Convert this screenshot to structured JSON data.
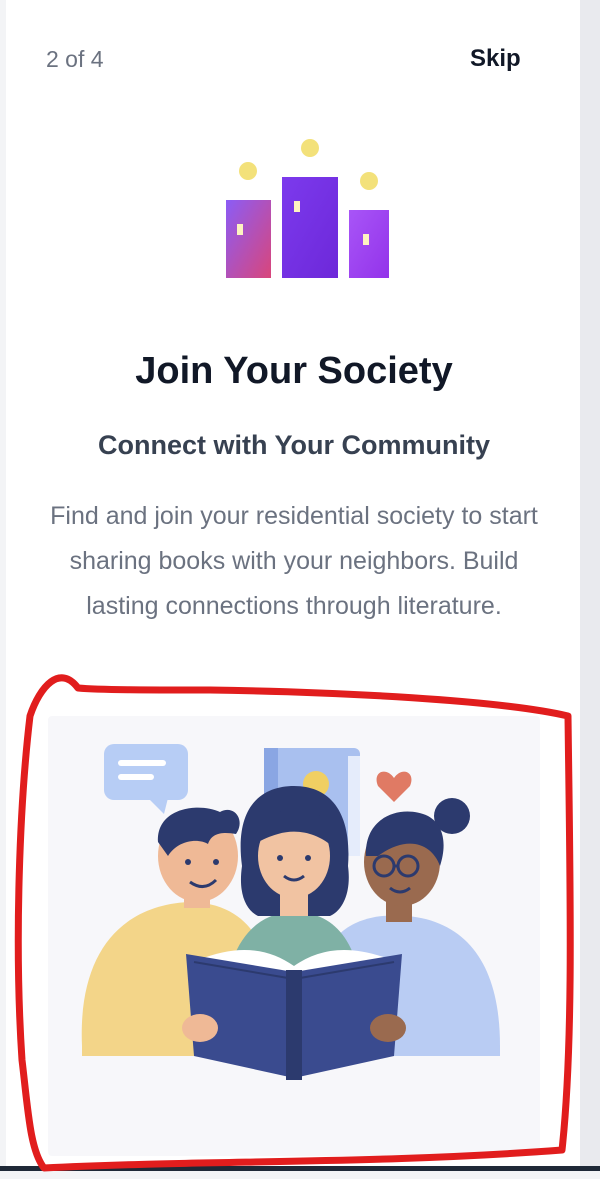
{
  "header": {
    "step_indicator": "2 of 4",
    "skip_label": "Skip"
  },
  "logo": {
    "icon": "society-buildings-icon"
  },
  "content": {
    "title": "Join Your Society",
    "subtitle": "Connect with Your Community",
    "description": "Find and join your residential society to start sharing books with your neighbors. Build lasting connections through literature."
  },
  "illustration": {
    "icon": "people-reading-book-illustration"
  },
  "colors": {
    "accent_purple": "#7c3aed",
    "annotation_red": "#e11d1d"
  }
}
